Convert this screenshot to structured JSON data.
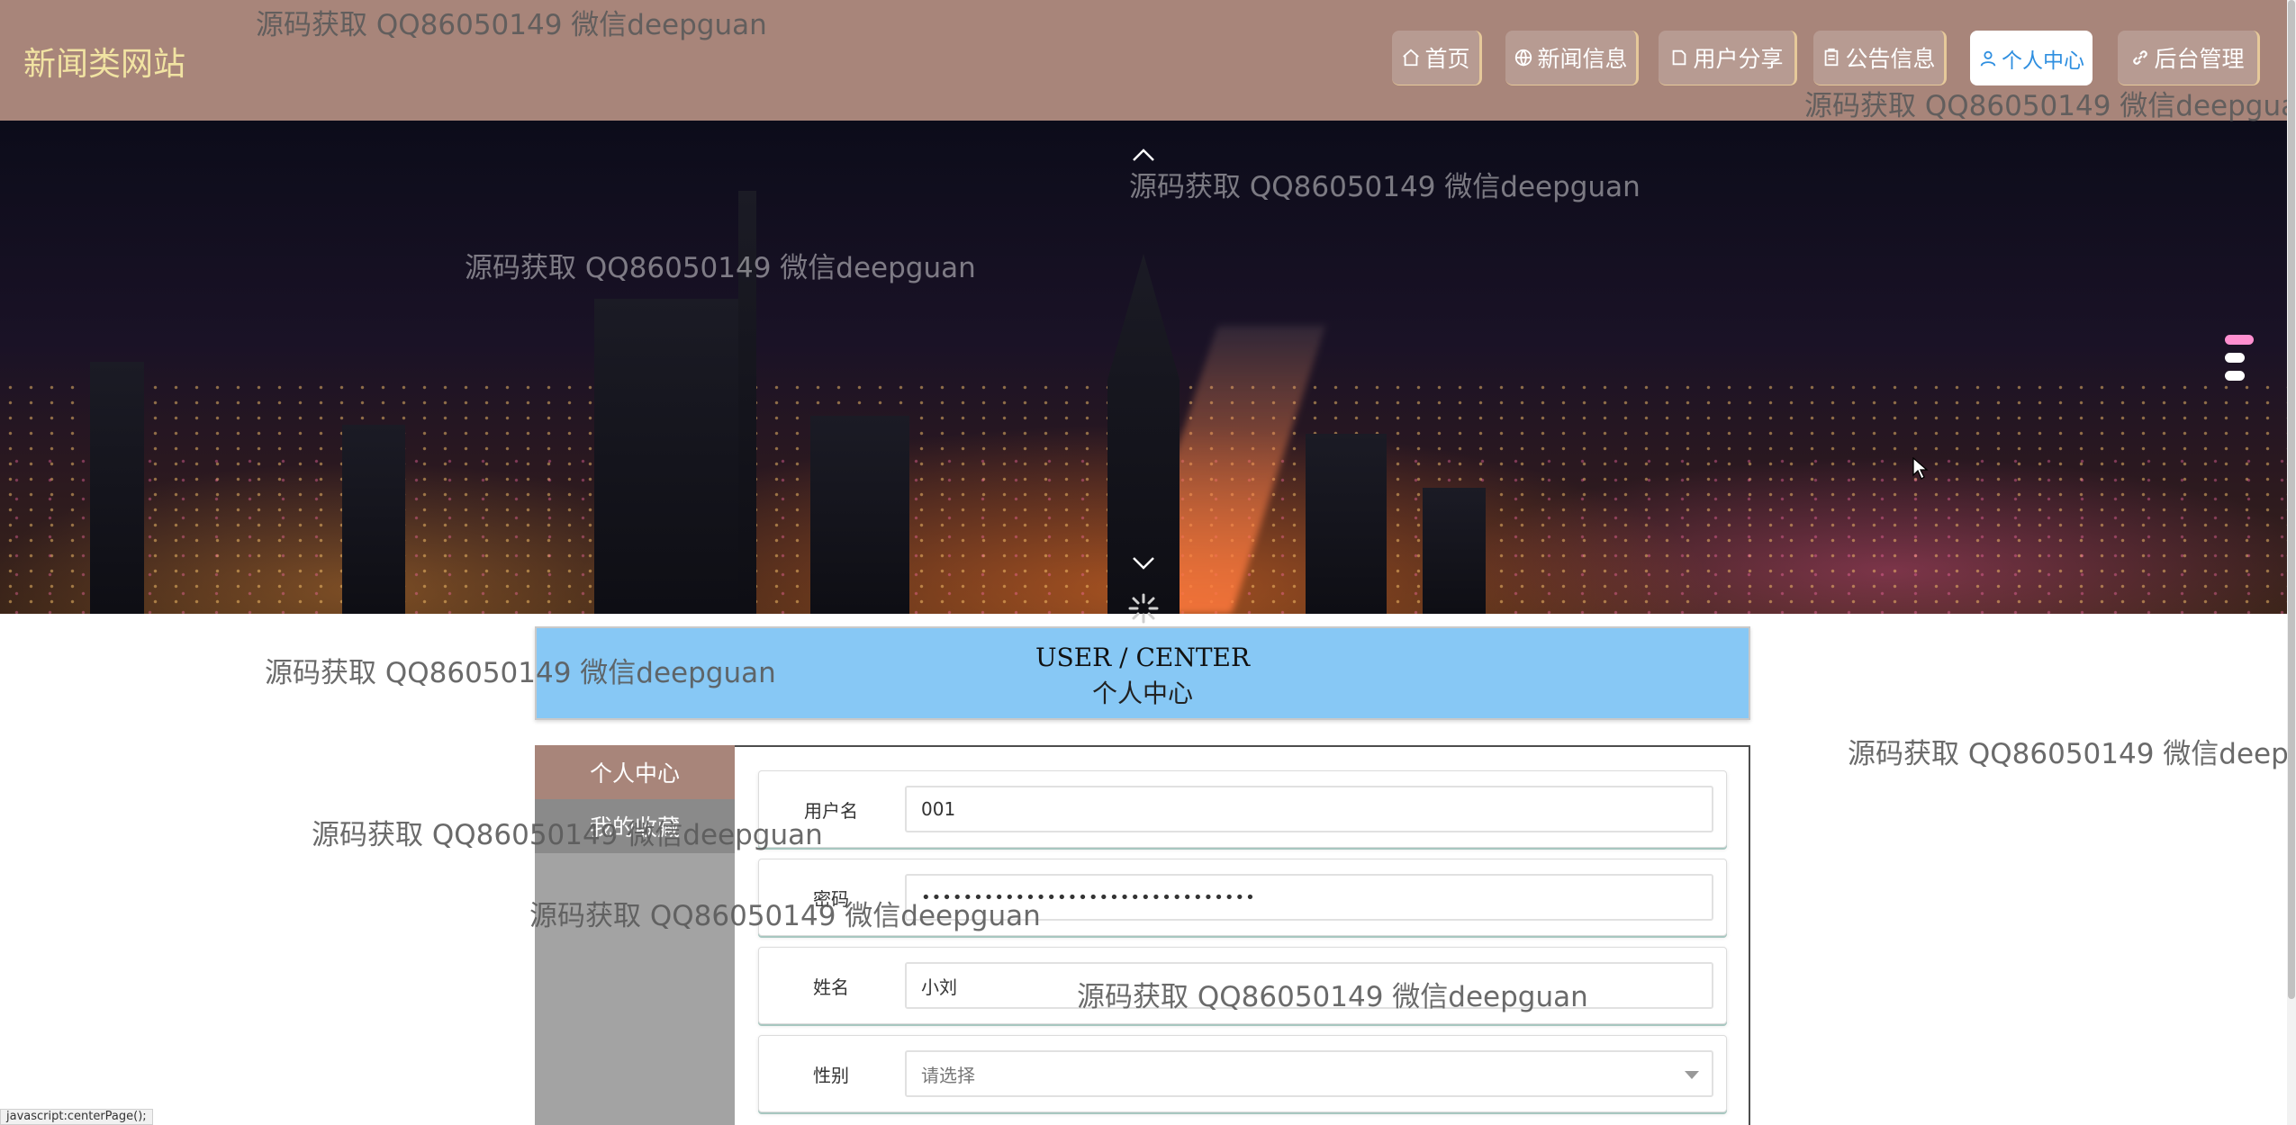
{
  "site": {
    "logo": "新闻类网站"
  },
  "nav": [
    {
      "label": "首页",
      "icon": "home-icon"
    },
    {
      "label": "新闻信息",
      "icon": "globe-icon"
    },
    {
      "label": "用户分享",
      "icon": "share-icon"
    },
    {
      "label": "公告信息",
      "icon": "clipboard-icon"
    },
    {
      "label": "个人中心",
      "icon": "user-icon",
      "active": true
    },
    {
      "label": "后台管理",
      "icon": "link-icon"
    }
  ],
  "banner": {
    "active_slide": 1,
    "slide_count": 3
  },
  "center": {
    "title_en": "USER / CENTER",
    "title_cn": "个人中心"
  },
  "sidebar": {
    "items": [
      {
        "label": "个人中心",
        "active": true
      },
      {
        "label": "我的收藏",
        "active": false
      }
    ]
  },
  "form": {
    "username": {
      "label": "用户名",
      "value": "001"
    },
    "password": {
      "label": "密码",
      "value": "••••••••••••••••••••••••••••••••"
    },
    "name": {
      "label": "姓名",
      "value": "小刘"
    },
    "gender": {
      "label": "性别",
      "placeholder": "请选择"
    }
  },
  "watermark": "源码获取 QQ86050149 微信deepguan",
  "status": {
    "text": "javascript:centerPage();"
  },
  "colors": {
    "header": "#a8857a",
    "logo": "#f1e3a2",
    "accent": "#87c8f5",
    "active_nav_text": "#2f8fe0"
  }
}
